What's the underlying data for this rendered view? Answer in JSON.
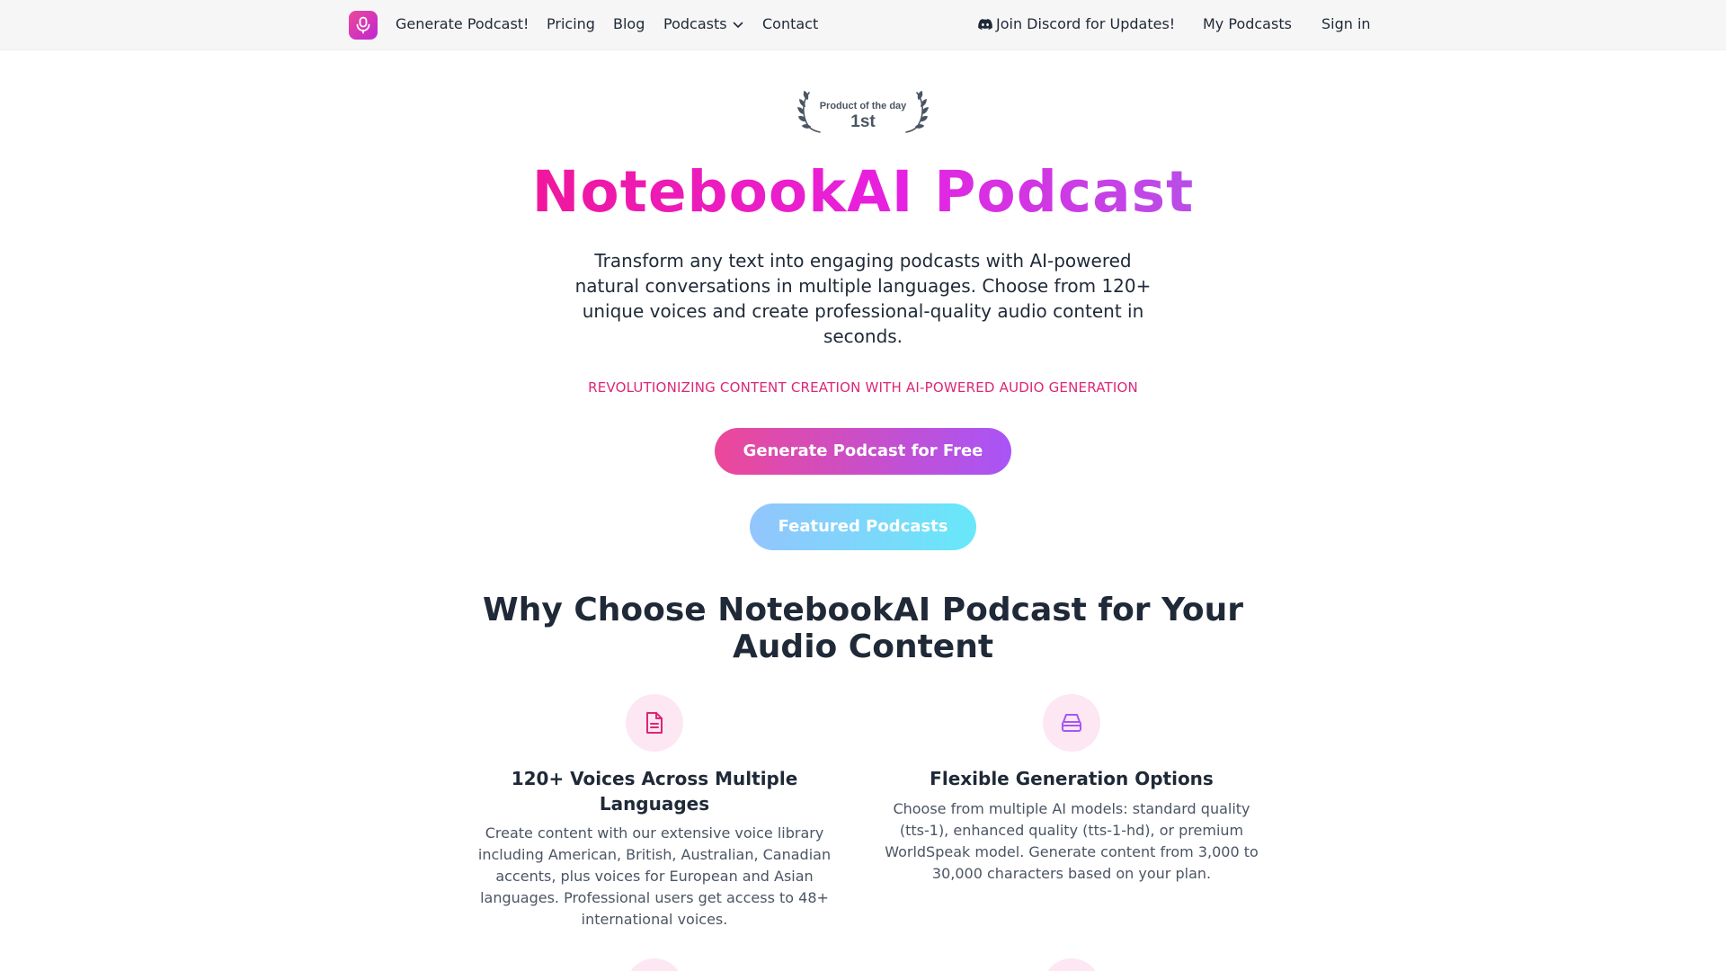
{
  "nav": {
    "links": [
      "Generate Podcast!",
      "Pricing",
      "Blog",
      "Podcasts",
      "Contact"
    ],
    "discord": "Join Discord for Updates!",
    "my_podcasts": "My Podcasts",
    "sign_in": "Sign in"
  },
  "badge": {
    "label": "Product of the day",
    "rank": "1st"
  },
  "hero": {
    "title": "NotebookAI Podcast",
    "description": "Transform any text into engaging podcasts with AI-powered natural conversations in multiple languages. Choose from 120+ unique voices and create professional-quality audio content in seconds.",
    "tagline": "REVOLUTIONIZING CONTENT CREATION WITH AI-POWERED AUDIO GENERATION",
    "primary_button": "Generate Podcast for Free",
    "secondary_button": "Featured Podcasts"
  },
  "section": {
    "title": "Why Choose NotebookAI Podcast for Your Audio Content",
    "features": [
      {
        "icon": "document-icon",
        "title": "120+ Voices Across Multiple Languages",
        "description": "Create content with our extensive voice library including American, British, Australian, Canadian accents, plus voices for European and Asian languages. Professional users get access to 48+ international voices."
      },
      {
        "icon": "inbox-icon",
        "title": "Flexible Generation Options",
        "description": "Choose from multiple AI models: standard quality (tts-1), enhanced quality (tts-1-hd), or premium WorldSpeak model. Generate content from 3,000 to 30,000 characters based on your plan."
      }
    ]
  },
  "colors": {
    "accent_pink": "#ec4899",
    "accent_purple": "#a855f7",
    "secondary_blue": "#93c5fd",
    "secondary_cyan": "#67e8f9",
    "icon_bg": "#fce7f3",
    "tagline": "#db2777"
  }
}
